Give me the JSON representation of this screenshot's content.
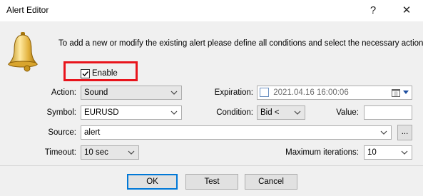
{
  "window": {
    "title": "Alert Editor",
    "help_glyph": "?",
    "close_glyph": "✕"
  },
  "description": "To add a new or modify the existing alert please define all conditions and select the necessary action.",
  "enable": {
    "label": "Enable",
    "checked": true
  },
  "action": {
    "label": "Action:",
    "value": "Sound"
  },
  "expiration": {
    "label": "Expiration:",
    "value": "2021.04.16 16:00:06",
    "checked": false
  },
  "symbol": {
    "label": "Symbol:",
    "value": "EURUSD"
  },
  "condition": {
    "label": "Condition:",
    "value": "Bid <"
  },
  "value_field": {
    "label": "Value:",
    "value": ""
  },
  "source": {
    "label": "Source:",
    "value": "alert",
    "browse_label": "..."
  },
  "timeout": {
    "label": "Timeout:",
    "value": "10 sec"
  },
  "max_iterations": {
    "label": "Maximum iterations:",
    "value": "10"
  },
  "buttons": {
    "ok": "OK",
    "test": "Test",
    "cancel": "Cancel"
  },
  "colors": {
    "highlight_box": "#e8141c",
    "default_button_border": "#0078d7"
  }
}
